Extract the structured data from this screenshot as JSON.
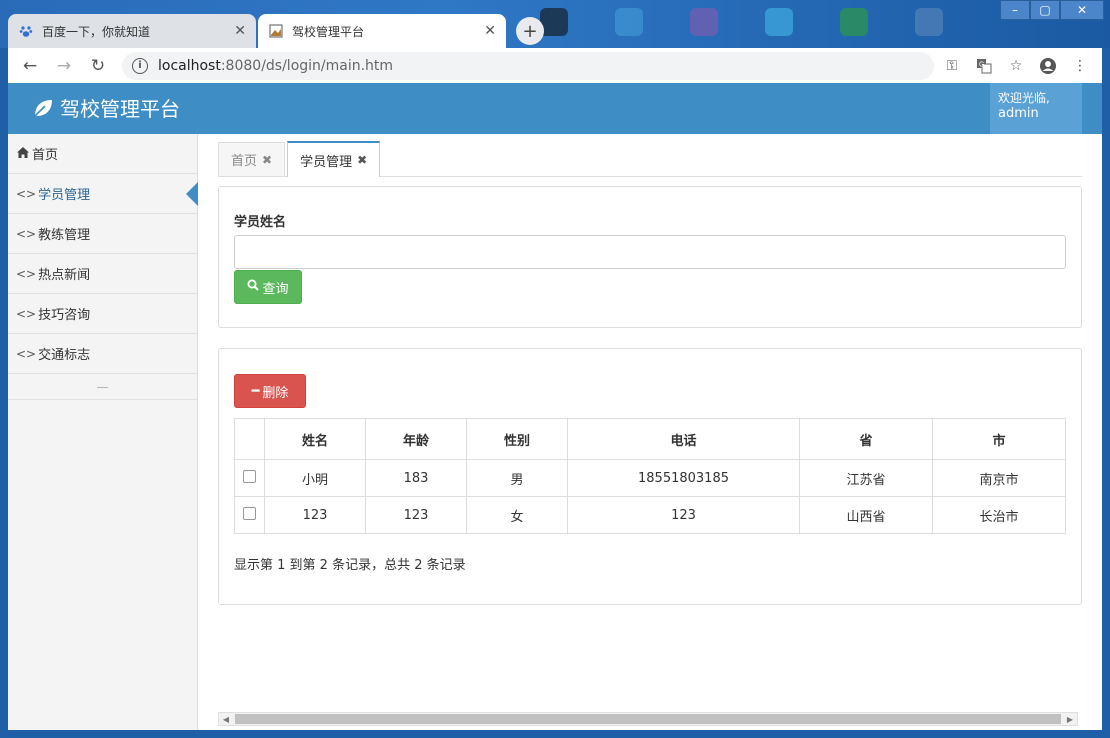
{
  "browser": {
    "tabs": [
      {
        "title": "百度一下，你就知道",
        "favicon": "baidu-paw-icon",
        "active": false
      },
      {
        "title": "驾校管理平台",
        "favicon": "page-image-icon",
        "active": true
      }
    ],
    "url_host": "localhost",
    "url_rest": ":8080/ds/login/main.htm"
  },
  "app": {
    "brand": "驾校管理平台",
    "welcome_line1": "欢迎光临,",
    "welcome_line2": "admin"
  },
  "sidebar": {
    "items": [
      {
        "label": "首页",
        "icon": "home-icon",
        "active": false
      },
      {
        "label": "学员管理",
        "icon": "code-icon",
        "active": true
      },
      {
        "label": "教练管理",
        "icon": "code-icon",
        "active": false
      },
      {
        "label": "热点新闻",
        "icon": "code-icon",
        "active": false
      },
      {
        "label": "技巧咨询",
        "icon": "code-icon",
        "active": false
      },
      {
        "label": "交通标志",
        "icon": "code-icon",
        "active": false
      }
    ]
  },
  "content_tabs": [
    {
      "label": "首页",
      "active": false
    },
    {
      "label": "学员管理",
      "active": true
    }
  ],
  "search": {
    "label": "学员姓名",
    "value": "",
    "button": "查询"
  },
  "actions": {
    "delete": "删除"
  },
  "table": {
    "columns": [
      "姓名",
      "年龄",
      "性别",
      "电话",
      "省",
      "市"
    ],
    "rows": [
      [
        "小明",
        "183",
        "男",
        "18551803185",
        "江苏省",
        "南京市"
      ],
      [
        "123",
        "123",
        "女",
        "123",
        "山西省",
        "长治市"
      ]
    ]
  },
  "pager": "显示第 1 到第 2 条记录，总共 2 条记录",
  "colors": {
    "header": "#3e8dc5",
    "success": "#5cb85c",
    "danger": "#d9534f"
  }
}
